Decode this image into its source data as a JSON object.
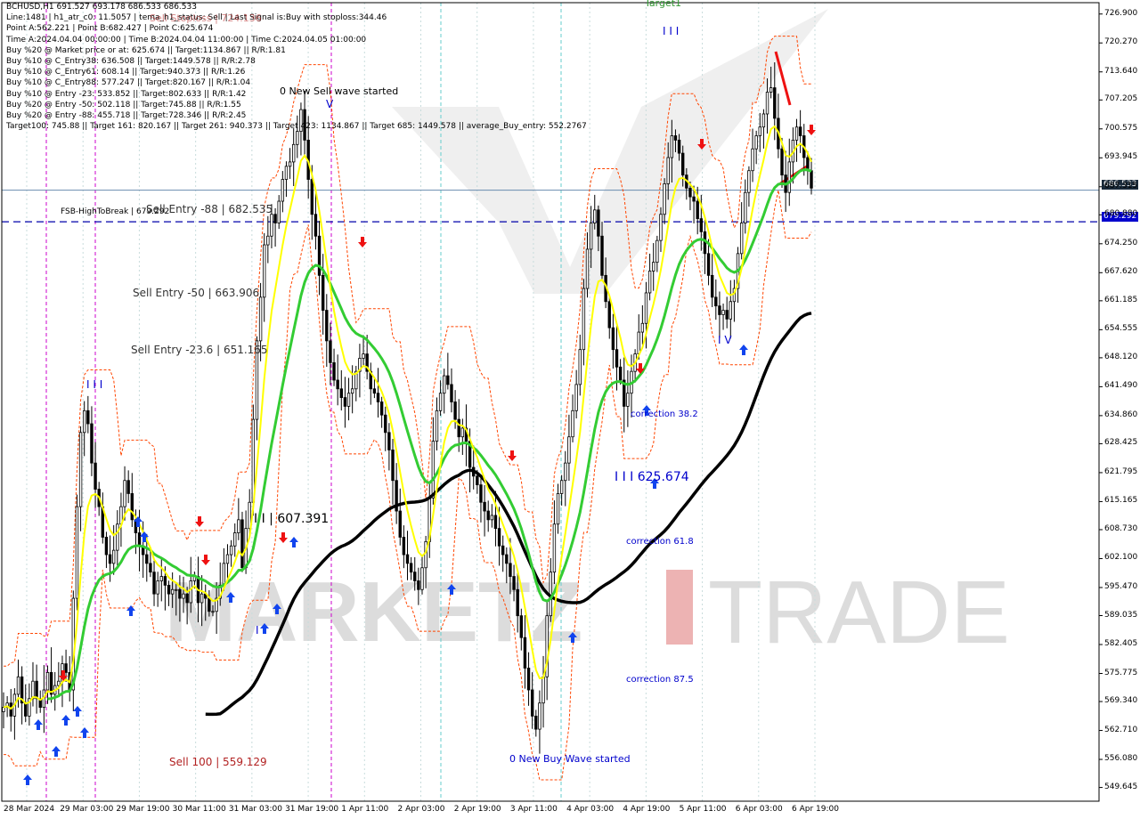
{
  "info_lines": [
    "BCHUSD,H1  691.527 693.178 686.533 686.533",
    "Line:1481  |  h1_atr_c0: 11.5057  |  tema_h1_status: Sell  |  Last Signal is:Buy with stoploss:344.46",
    "Point A:562.221  |  Point B:682.427  |  Point C:625.674",
    "Time A:2024.04.04 00:00:00  |  Time B:2024.04.04 11:00:00  |  Time C:2024.04.05 01:00:00",
    "Buy %20 @ Market price or at: 625.674  ||  Target:1134.867  ||  R/R:1.81",
    "Buy %10 @ C_Entry38: 636.508  ||  Target:1449.578  ||  R/R:2.78",
    "Buy %10 @ C_Entry61: 608.14  ||  Target:940.373  ||  R/R:1.26",
    "Buy %10 @ C_Entry88: 577.247  ||  Target:820.167  ||  R/R:1.04",
    "Buy %10 @ Entry -23: 533.852  ||  Target:802.633  ||  R/R:1.42",
    "Buy %20 @ Entry -50: 502.118  ||  Target:745.88  ||  R/R:1.55",
    "Buy %20 @ Entry -88: 455.718  ||  Target:728.346  ||  R/R:2.45",
    "Target100: 745.88  ||  Target 161: 820.167  ||  Target 261: 940.373  ||  Target 423: 1134.867  ||  Target 685: 1449.578  ||  average_Buy_entry: 552.2767"
  ],
  "annotations": {
    "new_sell_wave": "0 New Sell wave started",
    "new_buy_wave": "0 New Buy Wave started",
    "fsb": "FSB-HighToBreak | 679.292",
    "sell_entry_88": "Sell Entry -88 | 682.535",
    "sell_entry_50": "Sell Entry -50 | 663.906",
    "sell_entry_23": "Sell Entry -23.6 | 651.165",
    "sell_100": "Sell 100 | 559.129",
    "point_b_label": "I I | 607.391",
    "point_c_label": "I I I 625.674",
    "correction_38": "correction 38.2",
    "correction_61": "correction 61.8",
    "correction_87": "correction 87.5",
    "target1": "Target1",
    "wave_iii_top": "I I I",
    "wave_iii_left": "I I I",
    "wave_iv": "I V",
    "wave_v": "V",
    "wave_i": "I",
    "sell_stoploss_fragment": "Sell Stoploss | 724.136"
  },
  "watermark": {
    "left": "MARKETZ",
    "right": "TRADE"
  },
  "price_tags": {
    "current": "686.533",
    "fsb": "679.292"
  },
  "colors": {
    "sell_text": "#b22222",
    "buy_text": "#0000cc",
    "ema_fast": "#ffff00",
    "ema_mid": "#33cc33",
    "ema_slow": "#000000",
    "channel": "#ff4500",
    "fsb_line": "#0000aa",
    "current_line": "#6a8caf",
    "magenta_vline": "#cc00cc",
    "cyan_vline": "#66cccc"
  },
  "chart_data": {
    "type": "candlestick",
    "symbol": "BCHUSD",
    "timeframe": "H1",
    "ylim": [
      546.5,
      729.5
    ],
    "y_ticks": [
      "726.900",
      "720.270",
      "713.640",
      "707.205",
      "700.575",
      "693.945",
      "687.315",
      "680.880",
      "674.250",
      "667.620",
      "661.185",
      "654.555",
      "648.120",
      "641.490",
      "634.860",
      "628.425",
      "621.795",
      "615.165",
      "608.730",
      "602.100",
      "595.470",
      "589.035",
      "582.405",
      "575.775",
      "569.340",
      "562.710",
      "556.080",
      "549.645"
    ],
    "x_labels": [
      "28 Mar 2024",
      "29 Mar 03:00",
      "29 Mar 19:00",
      "30 Mar 11:00",
      "31 Mar 03:00",
      "31 Mar 19:00",
      "1 Apr 11:00",
      "2 Apr 03:00",
      "2 Apr 19:00",
      "3 Apr 11:00",
      "4 Apr 03:00",
      "4 Apr 19:00",
      "5 Apr 11:00",
      "6 Apr 03:00",
      "6 Apr 19:00"
    ],
    "close": [
      568,
      569,
      566,
      571,
      575,
      569,
      566,
      570,
      574,
      570,
      568,
      572,
      576,
      571,
      573,
      574,
      578,
      576,
      572,
      593,
      614,
      631,
      636,
      633,
      624,
      618,
      614,
      607,
      603,
      601,
      604,
      610,
      614,
      620,
      617,
      611,
      608,
      605,
      603,
      601,
      599,
      594,
      597,
      598,
      596,
      594,
      595,
      595,
      593,
      594,
      592,
      597,
      598,
      592,
      594,
      593,
      590,
      590,
      593,
      596,
      601,
      603,
      605,
      608,
      611,
      600,
      609,
      615,
      634,
      652,
      662,
      674,
      676,
      681,
      679,
      684,
      689,
      692,
      693,
      697,
      700,
      705,
      698,
      689,
      681,
      676,
      667,
      659,
      652,
      647,
      643,
      641,
      639,
      637,
      640,
      641,
      645,
      648,
      649,
      645,
      641,
      640,
      638,
      635,
      631,
      627,
      620,
      613,
      607,
      603,
      601,
      599,
      597,
      595,
      600,
      606,
      616,
      629,
      636,
      640,
      644,
      642,
      638,
      634,
      630,
      632,
      629,
      623,
      621,
      619,
      615,
      613,
      611,
      612,
      609,
      605,
      603,
      601,
      598,
      595,
      589,
      584,
      577,
      572,
      566,
      563,
      569,
      575,
      589,
      599,
      610,
      617,
      620,
      624,
      630,
      636,
      642,
      650,
      664,
      673,
      679,
      682,
      676,
      667,
      661,
      655,
      650,
      646,
      643,
      637,
      640,
      645,
      649,
      654,
      656,
      663,
      668,
      670,
      675,
      681,
      688,
      694,
      699,
      698,
      695,
      690,
      687,
      685,
      684,
      680,
      677,
      672,
      667,
      662,
      660,
      658,
      659,
      657,
      661,
      664,
      672,
      679,
      686,
      691,
      696,
      699,
      701,
      704,
      709,
      710,
      703,
      696,
      690,
      686,
      693,
      698,
      701,
      699,
      694,
      691,
      687
    ]
  }
}
